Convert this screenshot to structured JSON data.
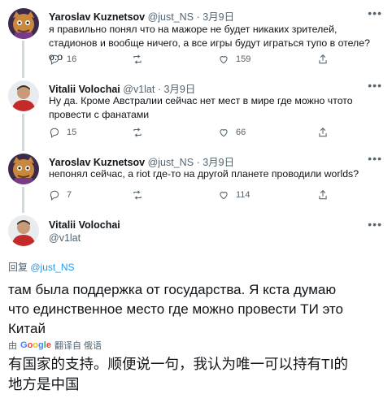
{
  "tweets": [
    {
      "name": "Yaroslav Kuznetsov",
      "handle": "@just_NS",
      "separator": "·",
      "date": "3月9日",
      "text_lines": [
        "я правильно понял что на мажоре не будет никаких зрителей,",
        "стадионов и вообще ничего, а все игры будут играться тупо в отеле? о.о"
      ],
      "replies": "16",
      "retweets": "",
      "likes": "159"
    },
    {
      "name": "Vitalii Volochai",
      "handle": "@v1lat",
      "separator": "·",
      "date": "3月9日",
      "text_lines": [
        "Ну да. Кроме Австралии сейчас нет мест в мире где можно чтото",
        "провести с фанатами"
      ],
      "replies": "15",
      "retweets": "",
      "likes": "66"
    },
    {
      "name": "Yaroslav Kuznetsov",
      "handle": "@just_NS",
      "separator": "·",
      "date": "3月9日",
      "text_lines": [
        "непонял сейчас, а riot где-то на другой планете проводили worlds?"
      ],
      "replies": "7",
      "retweets": "",
      "likes": "114"
    }
  ],
  "main_tweet": {
    "name": "Vitalii Volochai",
    "handle": "@v1lat",
    "reply_prefix": "回复",
    "reply_to": "@just_NS",
    "text_lines": [
      "там была поддержка от государства. Я кста думаю",
      "что единственное место где можно провести ТИ это",
      "Китай"
    ],
    "translate_prefix": "由",
    "translate_brand": "Google",
    "translate_suffix": "翻译自 俄语",
    "translated_lines": [
      "有国家的支持。顺便说一句，我认为唯一可以持有TI的",
      "地方是中国"
    ]
  },
  "icons": {
    "reply": "reply-icon",
    "retweet": "retweet-icon",
    "like": "like-icon",
    "share": "share-icon",
    "more": "more-icon"
  },
  "colors": {
    "link": "#1d9bf0",
    "muted": "#536471",
    "text": "#0f1419",
    "thread_line": "#cfd9de"
  }
}
